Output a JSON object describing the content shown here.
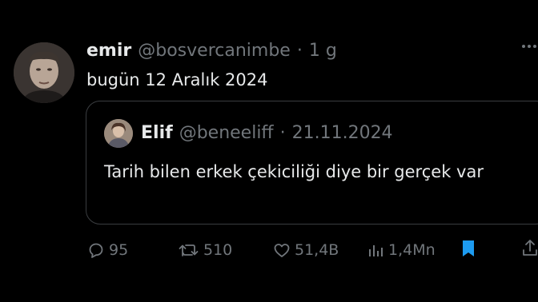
{
  "tweet": {
    "display_name": "emir",
    "handle": "@bosvercanimbe",
    "separator": "·",
    "time": "1 g",
    "text": "bugün 12 Aralık 2024"
  },
  "quoted": {
    "display_name": "Elif",
    "handle": "@beneeliff",
    "separator": "·",
    "date": "21.11.2024",
    "text": "Tarih bilen erkek çekiciliği diye bir gerçek var"
  },
  "actions": {
    "replies": "95",
    "retweets": "510",
    "likes": "51,4B",
    "views": "1,4Mn"
  },
  "colors": {
    "background": "#000000",
    "text": "#e7e9ea",
    "muted": "#71767b",
    "bookmark_active": "#1d9bf0",
    "border": "#3a3d40"
  }
}
